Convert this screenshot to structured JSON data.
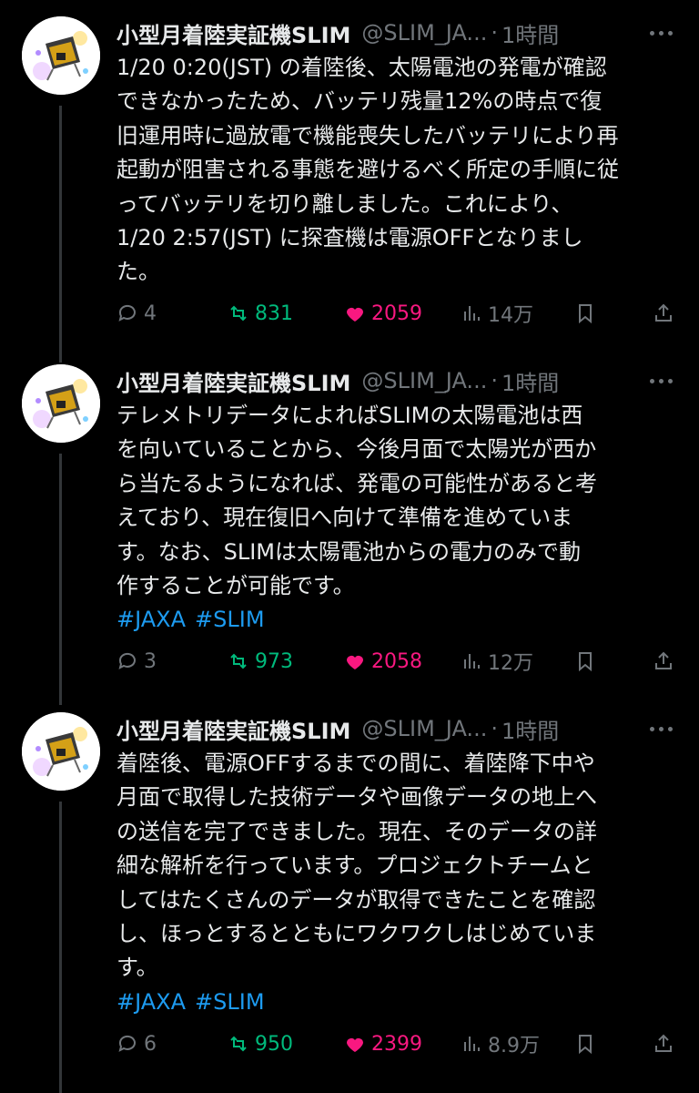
{
  "colors": {
    "background": "#000000",
    "text": "#e7e9ea",
    "muted": "#71767b",
    "hashtag": "#1d9bf0",
    "retweet": "#00ba7c",
    "like": "#f91880",
    "thread_line": "#333639"
  },
  "icons": {
    "reply": "speech-bubble-icon",
    "retweet": "retweet-arrows-icon",
    "like": "heart-icon",
    "views": "bar-chart-icon",
    "bookmark": "bookmark-icon",
    "share": "share-upload-icon",
    "more": "more-dots-icon"
  },
  "tweets": [
    {
      "name": "小型月着陸実証機SLIM",
      "handle": "@SLIM_JA...",
      "dot": "·",
      "time": "1時間",
      "lines": [
        "1/20 0:20(JST) の着陸後、太陽電池の発電が確認",
        "できなかったため、バッテリ残量12%の時点で復",
        "旧運用時に過放電で機能喪失したバッテリにより再",
        "起動が阻害される事態を避けるべく所定の手順に従",
        "ってバッテリを切り離しました。これにより、",
        "1/20 2:57(JST) に探査機は電源OFFとなりまし",
        "た。"
      ],
      "hashtags": [],
      "stats": {
        "replies": "4",
        "retweets": "831",
        "likes": "2059",
        "views": "14万"
      }
    },
    {
      "name": "小型月着陸実証機SLIM",
      "handle": "@SLIM_JA...",
      "dot": "·",
      "time": "1時間",
      "lines": [
        "テレメトリデータによればSLIMの太陽電池は西",
        "を向いていることから、今後月面で太陽光が西か",
        "ら当たるようになれば、発電の可能性があると考",
        "えており、現在復旧へ向けて準備を進めていま",
        "す。なお、SLIMは太陽電池からの電力のみで動",
        "作することが可能です。"
      ],
      "hashtags": [
        "#JAXA",
        "#SLIM"
      ],
      "stats": {
        "replies": "3",
        "retweets": "973",
        "likes": "2058",
        "views": "12万"
      }
    },
    {
      "name": "小型月着陸実証機SLIM",
      "handle": "@SLIM_JA...",
      "dot": "·",
      "time": "1時間",
      "lines": [
        "着陸後、電源OFFするまでの間に、着陸降下中や",
        "月面で取得した技術データや画像データの地上へ",
        "の送信を完了できました。現在、そのデータの詳",
        "細な解析を行っています。プロジェクトチームと",
        "してはたくさんのデータが取得できたことを確認",
        "し、ほっとするとともにワクワクしはじめていま",
        "す。"
      ],
      "hashtags": [
        "#JAXA",
        "#SLIM"
      ],
      "stats": {
        "replies": "6",
        "retweets": "950",
        "likes": "2399",
        "views": "8.9万"
      }
    }
  ]
}
